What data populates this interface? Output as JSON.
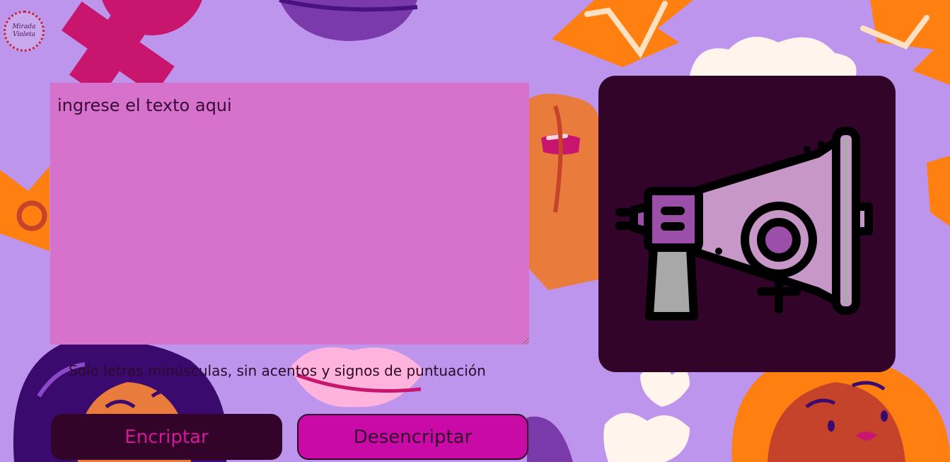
{
  "logo": {
    "line1": "Mirada",
    "line2": "Violeta"
  },
  "input": {
    "placeholder": "ingrese el texto aqui",
    "value": ""
  },
  "hint": {
    "text": "Solo letras minúsculas, sin acentos y signos de puntuación"
  },
  "buttons": {
    "encrypt_label": "Encriptar",
    "decrypt_label": "Desencriptar"
  },
  "output_panel": {
    "icon": "megaphone-female-symbol-icon"
  },
  "colors": {
    "background": "#bd95ec",
    "textarea": "#d672cc",
    "panel": "#32042a",
    "encrypt_button_bg": "#32042a",
    "encrypt_button_text": "#d3189a",
    "decrypt_button_bg": "#c90aa6",
    "decrypt_button_text": "#32042a"
  }
}
